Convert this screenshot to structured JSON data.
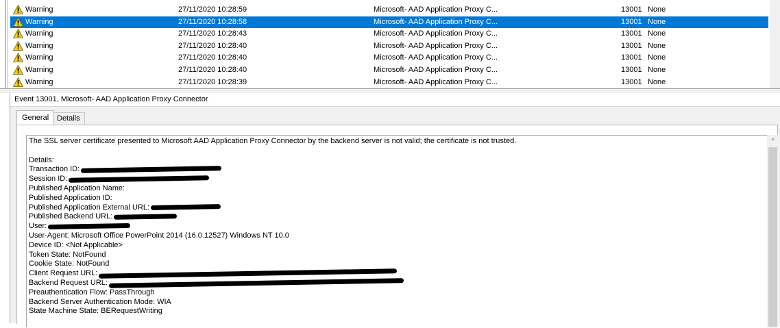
{
  "event_list": {
    "rows": [
      {
        "level": "Warning",
        "date": "27/11/2020 10:28:59",
        "source": "Microsoft- AAD Application Proxy C...",
        "event_id": "13001",
        "task": "None",
        "selected": false
      },
      {
        "level": "Warning",
        "date": "27/11/2020 10:28:58",
        "source": "Microsoft- AAD Application Proxy C...",
        "event_id": "13001",
        "task": "None",
        "selected": true
      },
      {
        "level": "Warning",
        "date": "27/11/2020 10:28:43",
        "source": "Microsoft- AAD Application Proxy C...",
        "event_id": "13001",
        "task": "None",
        "selected": false
      },
      {
        "level": "Warning",
        "date": "27/11/2020 10:28:40",
        "source": "Microsoft- AAD Application Proxy C...",
        "event_id": "13001",
        "task": "None",
        "selected": false
      },
      {
        "level": "Warning",
        "date": "27/11/2020 10:28:40",
        "source": "Microsoft- AAD Application Proxy C...",
        "event_id": "13001",
        "task": "None",
        "selected": false
      },
      {
        "level": "Warning",
        "date": "27/11/2020 10:28:40",
        "source": "Microsoft- AAD Application Proxy C...",
        "event_id": "13001",
        "task": "None",
        "selected": false
      },
      {
        "level": "Warning",
        "date": "27/11/2020 10:28:39",
        "source": "Microsoft- AAD Application Proxy C...",
        "event_id": "13001",
        "task": "None",
        "selected": false
      }
    ],
    "selection_color": "#0078d7",
    "warning_icon": "warning-icon"
  },
  "detail": {
    "title": "Event 13001, Microsoft- AAD Application Proxy Connector",
    "tabs": {
      "general": "General",
      "details": "Details"
    },
    "message": {
      "summary": "The SSL server certificate presented to Microsoft AAD Application Proxy Connector by the backend server is not valid; the certificate is not trusted.",
      "details_heading": "Details:",
      "transaction_id": "Transaction ID:",
      "session_id": "Session ID:",
      "published_app_name": "Published Application Name:",
      "published_app_id": "Published Application ID:",
      "published_app_external_url": "Published Application External URL:",
      "published_backend_url": "Published Backend URL:",
      "user": "User:",
      "user_agent": "User-Agent: Microsoft Office PowerPoint 2014 (16.0.12527) Windows NT 10.0",
      "device_id": "Device ID: <Not Applicable>",
      "token_state": "Token State: NotFound",
      "cookie_state": "Cookie State: NotFound",
      "client_request_url": "Client Request URL:",
      "backend_request_url": "Backend Request URL:",
      "preauth_flow": "Preauthentication Flow: PassThrough",
      "backend_auth_mode": "Backend Server Authentication Mode: WIA",
      "state_machine_state": "State Machine State: BERequestWriting"
    }
  },
  "scroll_up_glyph": "^"
}
